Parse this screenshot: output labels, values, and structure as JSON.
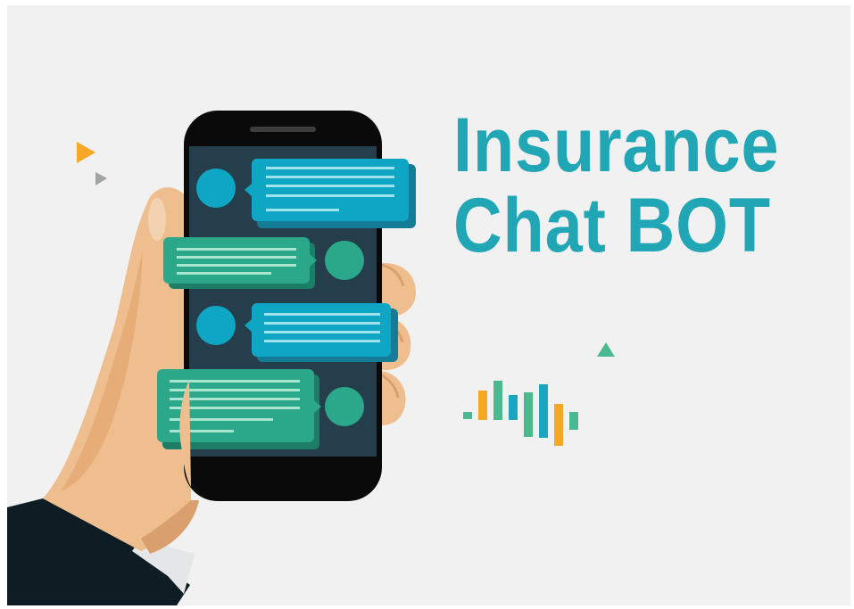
{
  "title": {
    "line1": "Insurance",
    "line2": "Chat BOT",
    "color": "#21a6b5"
  },
  "colors": {
    "background": "#f1f1f1",
    "skin": "#efbe8e",
    "skin_shadow": "#d99f6c",
    "sleeve": "#0e1c24",
    "cuff": "#e5e6e7",
    "phone_body": "#0a0a0a",
    "screen": "#243f4b",
    "bot_blue": "#0fa6c6",
    "user_green": "#2aa889",
    "accent_orange": "#f4a824",
    "accent_gray": "#9ea3a6"
  },
  "icons": [
    "play-triangle-orange-icon",
    "play-triangle-gray-icon",
    "up-triangle-green-icon",
    "sound-wave-icon"
  ],
  "chat": {
    "messages": [
      {
        "sender": "bot",
        "lines": 5
      },
      {
        "sender": "user",
        "lines": 4
      },
      {
        "sender": "bot",
        "lines": 4
      },
      {
        "sender": "user",
        "lines": 6
      }
    ]
  }
}
